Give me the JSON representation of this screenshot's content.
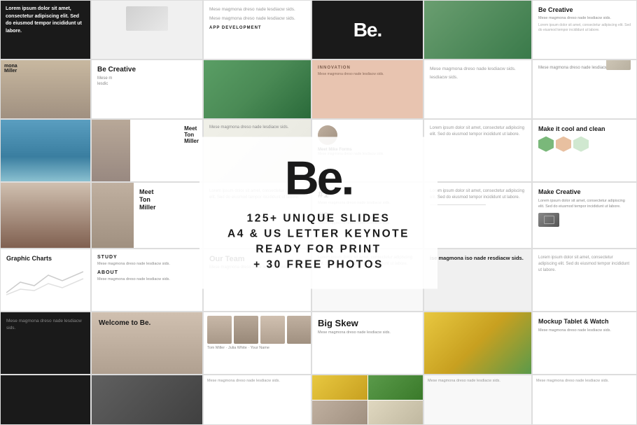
{
  "logo": "Be.",
  "features": [
    "125+ UNIQUE SLIDES",
    "A4 & US LETTER KEYNOTE",
    "READY FOR PRINT",
    "+ 30 FREE PHOTOS"
  ],
  "slides": {
    "be_creative_1": {
      "title": "Be Creative",
      "subtitle": "Mese magmona dreso nade lesdiacw sids."
    },
    "be_creative_2": {
      "title": "Be Creative",
      "subtitle": "Mese magmona dreso nade lesdiacw sids."
    },
    "meet_mike": {
      "title": "Meet Mike Forms"
    },
    "ton_miller": {
      "title": "Meet Tom Miller"
    },
    "graphic_charts": {
      "title": "Graphic Charts"
    },
    "welcome": {
      "title": "Welcome to Be."
    },
    "big_skew": {
      "title": "Big Skew",
      "subtitle": "Mese magmona dreso nade lesdiacw sids."
    },
    "mockup": {
      "title": "Mockup Tablet & Watch"
    },
    "make_cool": {
      "title": "Make it cool and clean"
    },
    "make_creative": {
      "title": "Make Creative"
    },
    "mese_magmona": {
      "title": "ise magmona iso nade resdiacw sids."
    },
    "our_team": {
      "title": "Our Team"
    },
    "app_development": {
      "title": "APP DEVELOPMENT"
    }
  },
  "text": {
    "lorem_short": "Mese magmona dreso nade lesdiacw sids.",
    "lorem_long": "Lorem ipsum dolor sit amet, consectetur adipiscing elit. Sed do eiusmod tempor incididunt ut labore.",
    "study": "STUDY",
    "about": "ABOUT",
    "ton": "Ton",
    "miller": "Miller",
    "creative_label": "Creative"
  },
  "colors": {
    "dark": "#1a1a1a",
    "light": "#f5f5f5",
    "peach": "#e8c4b0",
    "teal": "#5b8fa8",
    "accent": "#333333"
  }
}
